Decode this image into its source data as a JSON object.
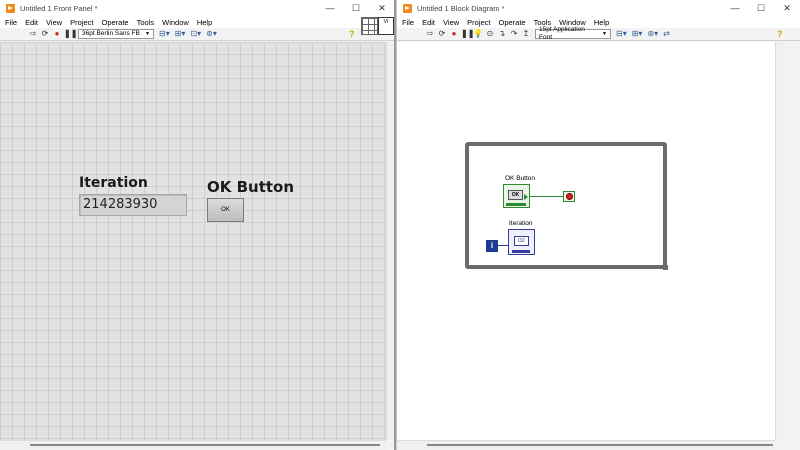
{
  "front_panel": {
    "title": "Untitled 1 Front Panel *",
    "menus": [
      "File",
      "Edit",
      "View",
      "Project",
      "Operate",
      "Tools",
      "Window",
      "Help"
    ],
    "font_selector": "36pt Berlin Sans FB",
    "iteration_label": "Iteration",
    "iteration_value": "214283930",
    "ok_label": "OK Button",
    "ok_text": "OK"
  },
  "block_diagram": {
    "title": "Untitled 1 Block Diagram *",
    "menus": [
      "File",
      "Edit",
      "View",
      "Project",
      "Operate",
      "Tools",
      "Window",
      "Help"
    ],
    "font_selector": "15pt Application Font",
    "ok_label": "OK Button",
    "ok_terminal_text": "OK",
    "iteration_label": "Iteration",
    "iteration_terminal_text": "I32",
    "loop_index_glyph": "i"
  },
  "window_controls": {
    "minimize": "—",
    "maximize": "☐",
    "close": "✕"
  },
  "colors": {
    "boolean_wire": "#2d8a2d",
    "integer_wire": "#1e3b94",
    "loop_border": "#6b6b6b",
    "grid_bg": "#e2e2e2"
  }
}
